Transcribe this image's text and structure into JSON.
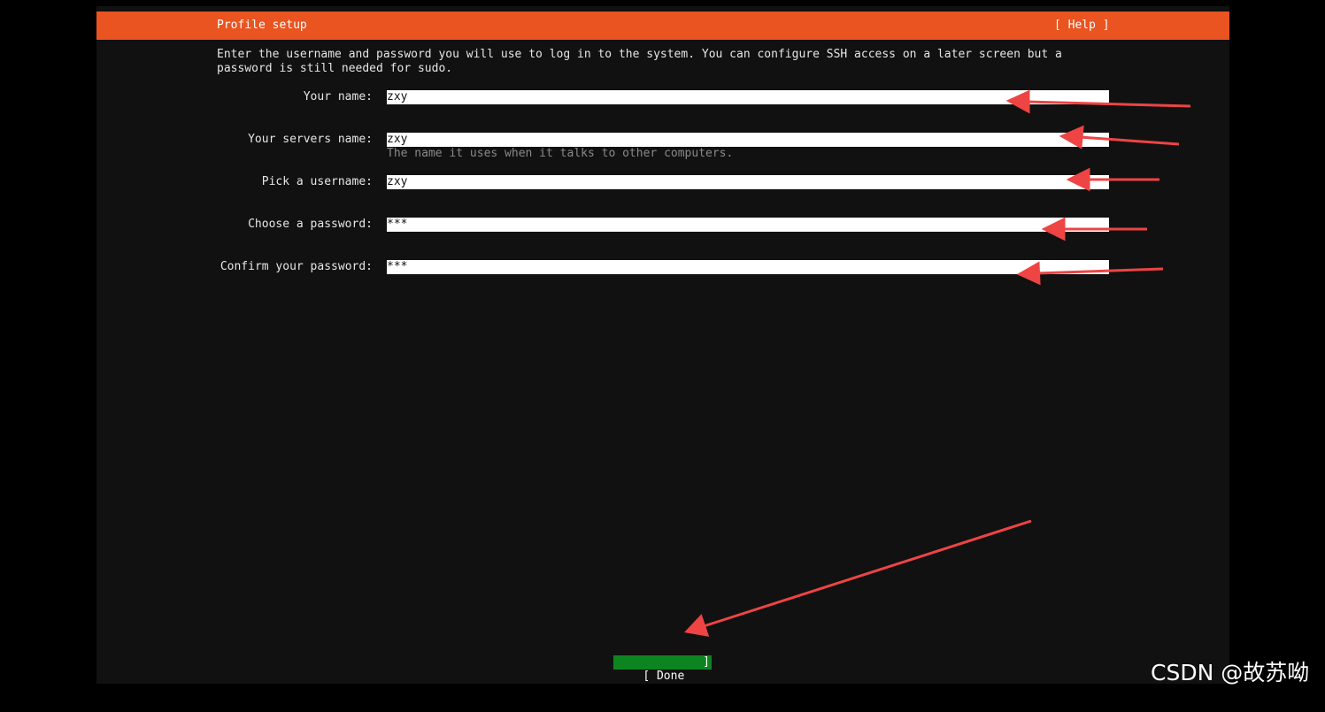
{
  "header": {
    "title": "Profile setup",
    "help_label": "[ Help ]"
  },
  "intro": "Enter the username and password you will use to log in to the system. You can configure SSH access on a later screen but a\npassword is still needed for sudo.",
  "fields": [
    {
      "label": "Your name:",
      "value": "zxy"
    },
    {
      "label": "Your servers name:",
      "value": "zxy",
      "hint": "The name it uses when it talks to other computers."
    },
    {
      "label": "Pick a username:",
      "value": "zxy"
    },
    {
      "label": "Choose a password:",
      "value": "***"
    },
    {
      "label": "Confirm your password:",
      "value": "***"
    }
  ],
  "footer": {
    "done_label": "[ Done",
    "done_right": "]"
  },
  "annotation_color": "#ee4444",
  "watermark": "CSDN @故苏呦"
}
